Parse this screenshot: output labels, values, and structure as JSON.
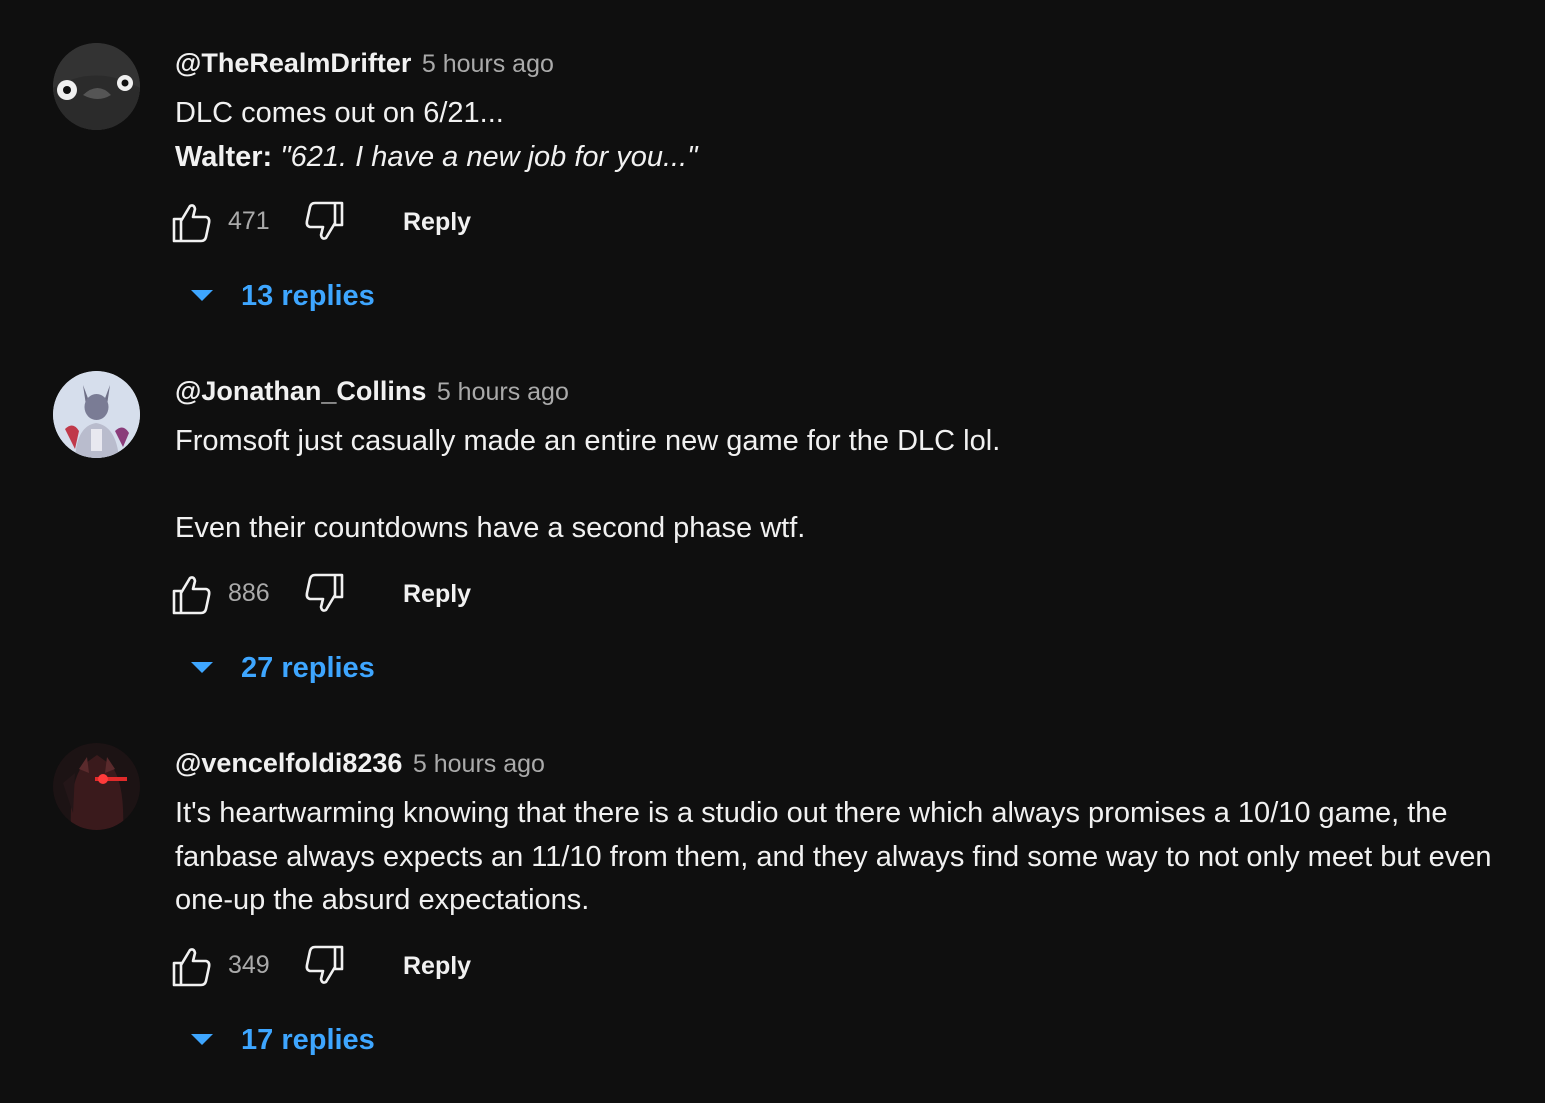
{
  "comments": [
    {
      "handle": "@TheRealmDrifter",
      "time": "5 hours ago",
      "line1": "DLC comes out on 6/21...",
      "speaker": "Walter:",
      "quote": "\"621. I have a new job for you...\"",
      "likes": "471",
      "reply_label": "Reply",
      "replies_label": "13 replies"
    },
    {
      "handle": "@Jonathan_Collins",
      "time": "5 hours ago",
      "line1": "Fromsoft just casually made an entire new game for the DLC lol.",
      "line2": "Even their countdowns have a second phase wtf.",
      "likes": "886",
      "reply_label": "Reply",
      "replies_label": "27 replies"
    },
    {
      "handle": "@vencelfoldi8236",
      "time": "5 hours ago",
      "text": "It's heartwarming knowing that there is a studio out there which always promises a 10/10 game, the fanbase always expects an 11/10 from them, and they always find some way to not only meet but even one-up the absurd expectations.",
      "likes": "349",
      "reply_label": "Reply",
      "replies_label": "17 replies"
    }
  ],
  "colors": {
    "background": "#0f0f0f",
    "primary_text": "#f1f1f1",
    "secondary_text": "#aaaaaa",
    "link_blue": "#3ea6ff"
  },
  "icons": {
    "like": "thumbs-up-outline",
    "dislike": "thumbs-down-outline",
    "replies": "caret-down"
  }
}
